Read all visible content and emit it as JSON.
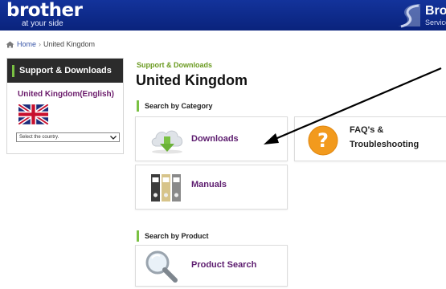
{
  "header": {
    "logo_main": "brother",
    "logo_sub": "at your side",
    "brand_title": "Brot",
    "brand_sub": "Service"
  },
  "breadcrumb": {
    "home": "Home",
    "separator": "›",
    "current": "United Kingdom"
  },
  "sidebar": {
    "title": "Support & Downloads",
    "country": "United Kingdom(English)",
    "select_value": "Select the country."
  },
  "main": {
    "kicker": "Support & Downloads",
    "title": "United Kingdom",
    "section_category": "Search by Category",
    "section_product": "Search by Product",
    "cards": {
      "downloads": "Downloads",
      "faq_line1": "FAQ's &",
      "faq_line2": "Troubleshooting",
      "manuals": "Manuals",
      "product_search": "Product Search"
    }
  },
  "colors": {
    "header_blue": "#0d2a8a",
    "accent_green": "#7ac143",
    "link_purple": "#5c1b6e",
    "faq_orange": "#f29a1d"
  }
}
